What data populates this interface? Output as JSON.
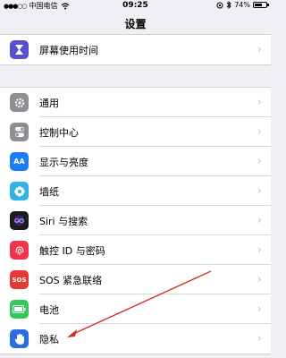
{
  "status_bar": {
    "carrier": "中国电信",
    "time": "09:25",
    "battery_percent": "74%",
    "battery_level": 0.74
  },
  "nav": {
    "title": "设置"
  },
  "top_group": {
    "items": [
      {
        "label": "屏幕使用时间",
        "icon": "hourglass-icon",
        "color": "#5a4fcf"
      }
    ]
  },
  "main_group": {
    "items": [
      {
        "label": "通用",
        "icon": "gear-icon",
        "color": "#8e8e93"
      },
      {
        "label": "控制中心",
        "icon": "toggles-icon",
        "color": "#8e8e93"
      },
      {
        "label": "显示与亮度",
        "icon": "text-size-icon",
        "color": "#1a7ef5",
        "glyph": "AA"
      },
      {
        "label": "墙纸",
        "icon": "flower-icon",
        "color": "#2fb2e6"
      },
      {
        "label": "Siri 与搜索",
        "icon": "siri-icon",
        "color": "#1c1c1e"
      },
      {
        "label": "触控 ID 与密码",
        "icon": "fingerprint-icon",
        "color": "#f0344b"
      },
      {
        "label": "SOS 紧急联络",
        "icon": "sos-icon",
        "color": "#e53935",
        "glyph": "SOS"
      },
      {
        "label": "电池",
        "icon": "battery-icon",
        "color": "#34c759"
      },
      {
        "label": "隐私",
        "icon": "hand-icon",
        "color": "#2a6fe0"
      }
    ]
  },
  "annotation": {
    "color": "#d0301f"
  }
}
